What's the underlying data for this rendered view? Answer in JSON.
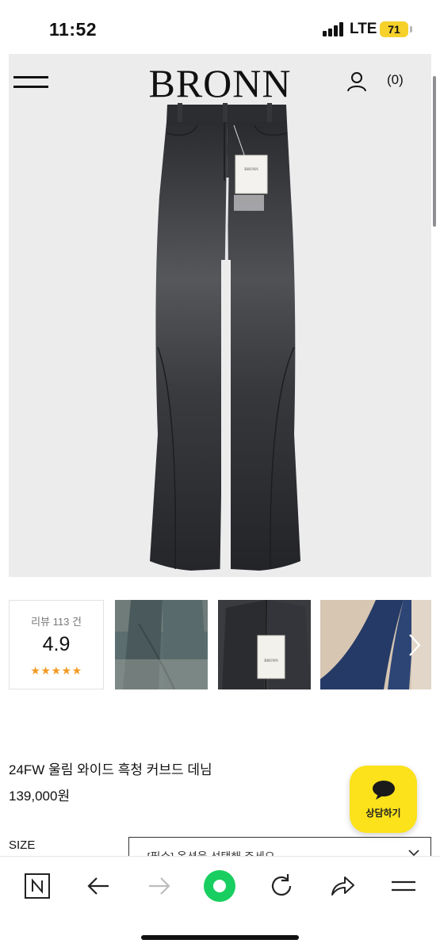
{
  "status_bar": {
    "time": "11:52",
    "network": "LTE",
    "battery": "71"
  },
  "header": {
    "brand": "BRONN",
    "cart_count": "(0)"
  },
  "reviews": {
    "label": "리뷰 113 건",
    "score": "4.9",
    "stars": "★★★★★"
  },
  "product": {
    "title": "24FW 울림 와이드 흑청 커브드 데님",
    "price": "139,000원",
    "tag_brand": "BRONN"
  },
  "chat": {
    "label": "상담하기"
  },
  "options": {
    "size_label": "SIZE",
    "size_placeholder": "- [필수] 옵션을 선택해 주세요 -"
  },
  "toolbar": {
    "icons": [
      "naver-icon",
      "back-arrow-icon",
      "forward-arrow-icon",
      "green-dot-icon",
      "reload-icon",
      "share-icon",
      "menu-icon"
    ]
  },
  "colors": {
    "accent_yellow": "#fbe21a",
    "star_orange": "#f29a24",
    "naver_green": "#19ce60"
  }
}
